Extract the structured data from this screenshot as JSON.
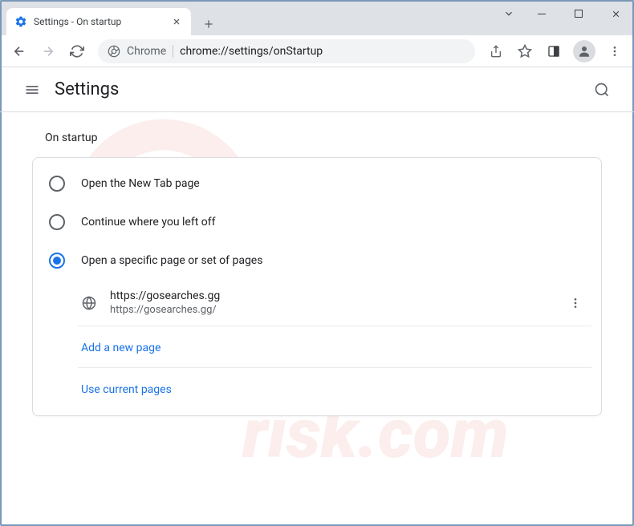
{
  "window": {
    "tab_title": "Settings - On startup"
  },
  "toolbar": {
    "chrome_label": "Chrome",
    "url": "chrome://settings/onStartup"
  },
  "header": {
    "title": "Settings"
  },
  "section": {
    "title": "On startup",
    "options": [
      {
        "label": "Open the New Tab page",
        "selected": false
      },
      {
        "label": "Continue where you left off",
        "selected": false
      },
      {
        "label": "Open a specific page or set of pages",
        "selected": true
      }
    ],
    "pages": [
      {
        "name": "https://gosearches.gg",
        "url": "https://gosearches.gg/"
      }
    ],
    "add_page_label": "Add a new page",
    "use_current_label": "Use current pages"
  }
}
